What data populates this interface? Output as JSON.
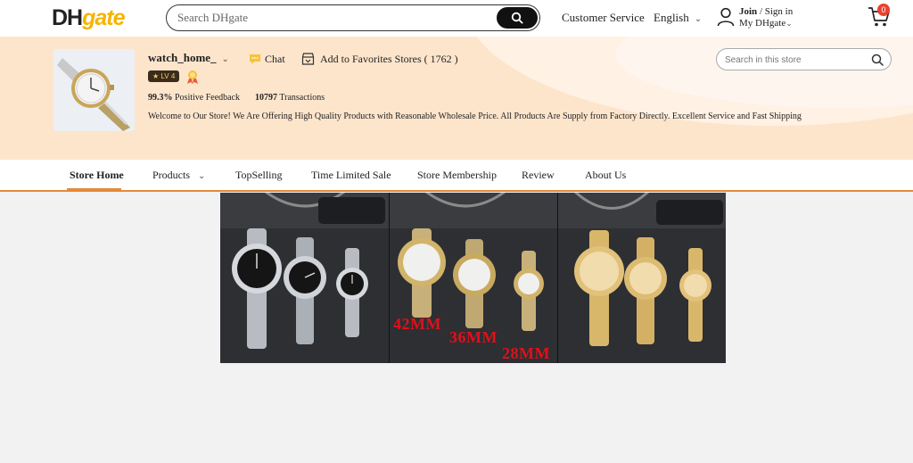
{
  "header": {
    "logo_dh": "DH",
    "logo_gate": "gate",
    "search_placeholder": "Search DHgate",
    "customer_service": "Customer Service",
    "language": "English",
    "join": "Join",
    "sign_in": "/ Sign in",
    "my_dhgate": "My DHgate",
    "cart_count": "0"
  },
  "store": {
    "name": "watch_home_",
    "level": "LV 4",
    "chat_label": "Chat",
    "favorites_label": "Add to Favorites Stores ( 1762 )",
    "positive_pct": "99.3%",
    "positive_label": "Positive Feedback",
    "transactions_count": "10797",
    "transactions_label": "Transactions",
    "welcome": "Welcome to Our Store! We Are Offering High Quality Products with Reasonable Wholesale Price. All Products Are Supply from Factory Directly. Excellent Service and Fast Shipping",
    "search_placeholder": "Search in this store"
  },
  "nav": {
    "items": [
      "Store Home",
      "Products",
      "TopSelling",
      "Time Limited Sale",
      "Store Membership",
      "Review",
      "About Us"
    ],
    "active": "Store Home"
  },
  "hero": {
    "size_labels": [
      "42MM",
      "36MM",
      "28MM"
    ]
  },
  "colors": {
    "accent": "#e58a3a",
    "banner_bg": "#fde5cc",
    "logo_gold": "#f6b400",
    "badge_red": "#e8422e",
    "size_label_red": "#e0101a"
  }
}
